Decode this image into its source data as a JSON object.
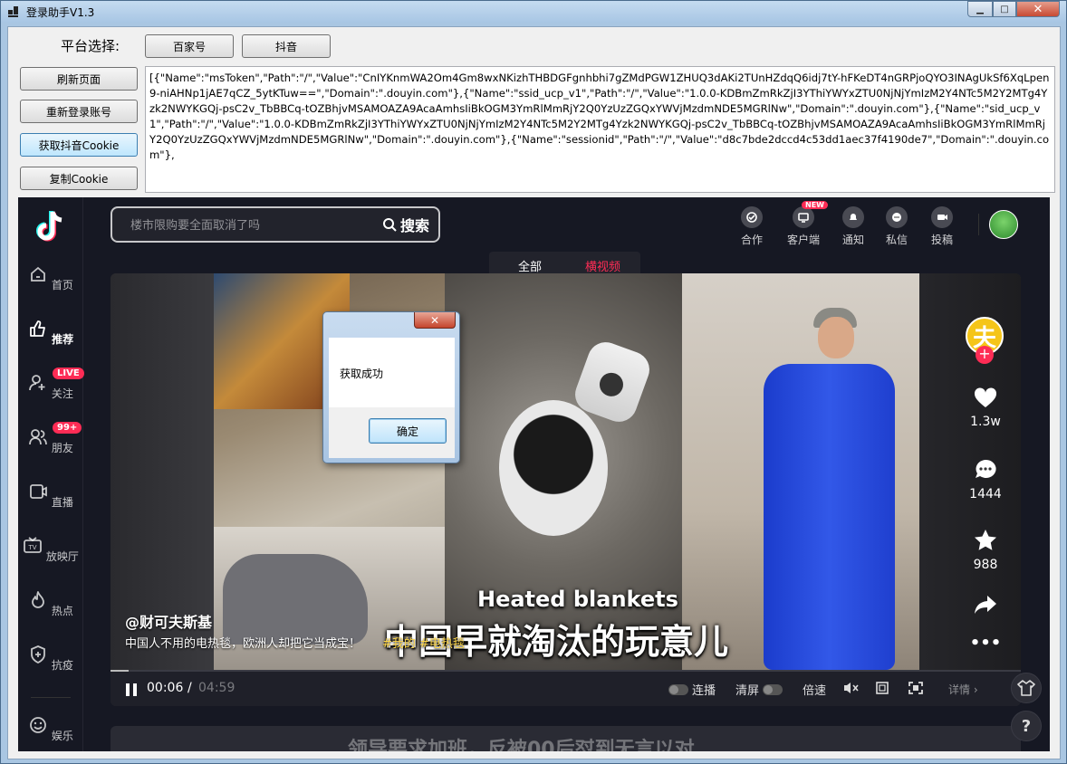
{
  "window": {
    "title": "登录助手V1.3"
  },
  "platform": {
    "label": "平台选择:",
    "buttons": [
      "百家号",
      "抖音"
    ]
  },
  "actions": {
    "refresh": "刷新页面",
    "relogin": "重新登录账号",
    "get_cookie": "获取抖音Cookie",
    "copy_cookie": "复制Cookie"
  },
  "cookie_text": "[{\"Name\":\"msToken\",\"Path\":\"/\",\"Value\":\"CnIYKnmWA2Om4Gm8wxNKizhTHBDGFgnhbhi7gZMdPGW1ZHUQ3dAKi2TUnHZdqQ6idj7tY-hFKeDT4nGRPjoQYO3INAgUkSf6XqLpen9-niAHNp1jAE7qCZ_5ytKTuw==\",\"Domain\":\".douyin.com\"},{\"Name\":\"ssid_ucp_v1\",\"Path\":\"/\",\"Value\":\"1.0.0-KDBmZmRkZjI3YThiYWYxZTU0NjNjYmIzM2Y4NTc5M2Y2MTg4Yzk2NWYKGQj-psC2v_TbBBCq-tOZBhjvMSAMOAZA9AcaAmhsIiBkOGM3YmRlMmRjY2Q0YzUzZGQxYWVjMzdmNDE5MGRlNw\",\"Domain\":\".douyin.com\"},{\"Name\":\"sid_ucp_v1\",\"Path\":\"/\",\"Value\":\"1.0.0-KDBmZmRkZjI3YThiYWYxZTU0NjNjYmIzM2Y4NTc5M2Y2MTg4Yzk2NWYKGQj-psC2v_TbBBCq-tOZBhjvMSAMOAZA9AcaAmhsIiBkOGM3YmRlMmRjY2Q0YzUzZGQxYWVjMzdmNDE5MGRlNw\",\"Domain\":\".douyin.com\"},{\"Name\":\"sessionid\",\"Path\":\"/\",\"Value\":\"d8c7bde2dccd4c53dd1aec37f4190de7\",\"Domain\":\".douyin.com\"},",
  "douyin": {
    "search": {
      "placeholder": "楼市限购要全面取消了吗",
      "button": "搜索"
    },
    "top_actions": [
      {
        "label": "合作",
        "icon": "cooperate-icon"
      },
      {
        "label": "客户端",
        "icon": "client-icon",
        "badge": "NEW"
      },
      {
        "label": "通知",
        "icon": "bell-icon"
      },
      {
        "label": "私信",
        "icon": "message-icon"
      },
      {
        "label": "投稿",
        "icon": "upload-icon"
      }
    ],
    "nav": [
      {
        "label": "首页",
        "icon": "home-icon"
      },
      {
        "label": "推荐",
        "icon": "thumbs-up-icon"
      },
      {
        "label": "关注",
        "icon": "follow-icon",
        "badge": "LIVE"
      },
      {
        "label": "朋友",
        "icon": "friends-icon",
        "badge": "99+"
      },
      {
        "label": "直播",
        "icon": "live-icon"
      },
      {
        "label": "放映厅",
        "icon": "tv-icon"
      },
      {
        "label": "热点",
        "icon": "flame-icon"
      },
      {
        "label": "抗疫",
        "icon": "shield-plus-icon"
      },
      {
        "label": "娱乐",
        "icon": "smile-icon"
      }
    ],
    "tabs": {
      "all": "全部",
      "horizontal": "横视频"
    },
    "video": {
      "author": "@财可夫斯基",
      "description": "中国人不用的电热毯，欧洲人却把它当成宝！",
      "tags": "#我的 #电热毯",
      "subtitle_en": "Heated blankets",
      "subtitle_cn": "中国早就淘汰的玩意儿",
      "author_avatar_char": "夫",
      "likes": "1.3w",
      "comments": "1444",
      "favorites": "988",
      "time_current": "00:06",
      "time_sep": "/",
      "time_total": "04:59",
      "progress": 0.02,
      "controls": {
        "autoplay": "连播",
        "clear": "清屏",
        "speed": "倍速",
        "detail": "详情 ›"
      }
    },
    "next_video_text": "领导要求加班，反被00后怼到无言以对"
  },
  "dialog": {
    "message": "获取成功",
    "ok": "确定"
  }
}
